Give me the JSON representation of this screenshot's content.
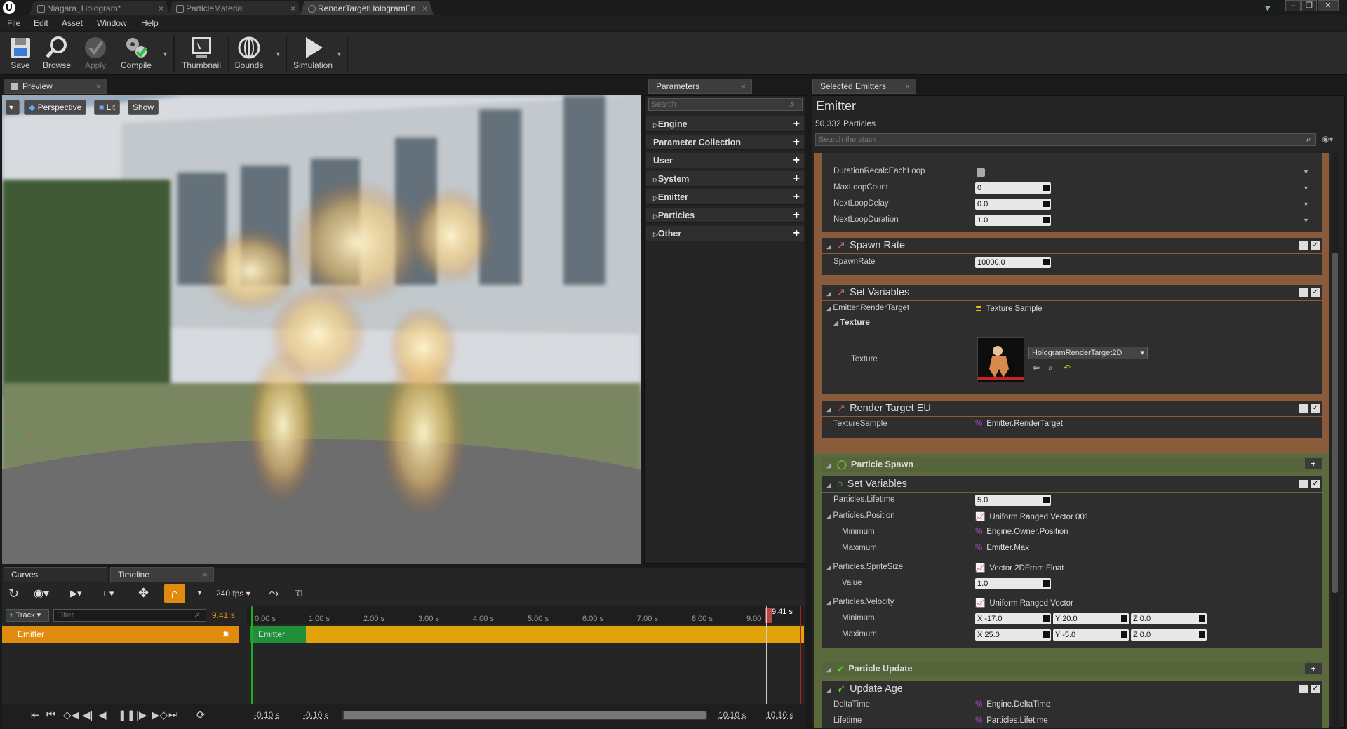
{
  "tabs": [
    {
      "label": "Niagara_Hologram*",
      "active": false
    },
    {
      "label": "ParticleMaterial",
      "active": false
    },
    {
      "label": "RenderTargetHologramEn",
      "active": true
    }
  ],
  "menu": [
    "File",
    "Edit",
    "Asset",
    "Window",
    "Help"
  ],
  "toolbar": {
    "save": "Save",
    "browse": "Browse",
    "apply": "Apply",
    "compile": "Compile",
    "thumbnail": "Thumbnail",
    "bounds": "Bounds",
    "simulation": "Simulation"
  },
  "preview": {
    "tab": "Preview",
    "perspective": "Perspective",
    "lit": "Lit",
    "show": "Show"
  },
  "parameters": {
    "tab": "Parameters",
    "search_placeholder": "Search",
    "rows": [
      "Engine",
      "Parameter Collection",
      "User",
      "System",
      "Emitter",
      "Particles",
      "Other"
    ]
  },
  "selected": {
    "tab": "Selected Emitters",
    "title": "Emitter",
    "particles": "50,332 Particles",
    "search_placeholder": "Search the stack"
  },
  "stack": {
    "top_rows": [
      {
        "label": "DurationRecalcEachLoop",
        "value": ""
      },
      {
        "label": "MaxLoopCount",
        "value": "0"
      },
      {
        "label": "NextLoopDelay",
        "value": "0.0"
      },
      {
        "label": "NextLoopDuration",
        "value": "1.0"
      }
    ],
    "spawn_rate": {
      "title": "Spawn Rate",
      "label": "SpawnRate",
      "value": "10000.0"
    },
    "set_vars1": {
      "title": "Set Variables",
      "row_label": "Emitter.RenderTarget",
      "row_value": "Texture Sample",
      "texture_group": "Texture",
      "texture_label": "Texture",
      "texture_asset": "HologramRenderTarget2D"
    },
    "render_target": {
      "title": "Render Target EU",
      "label": "TextureSample",
      "value": "Emitter.RenderTarget"
    },
    "particle_spawn": "Particle Spawn",
    "set_vars2": {
      "title": "Set Variables",
      "lifetime_label": "Particles.Lifetime",
      "lifetime": "5.0",
      "pos_label": "Particles.Position",
      "pos_value": "Uniform Ranged Vector 001",
      "min_label": "Minimum",
      "min_value": "Engine.Owner.Position",
      "max_label": "Maximum",
      "max_value": "Emitter.Max",
      "size_label": "Particles.SpriteSize",
      "size_value": "Vector 2DFrom Float",
      "value_label": "Value",
      "value": "1.0",
      "vel_label": "Particles.Velocity",
      "vel_value": "Uniform Ranged Vector",
      "vmin_label": "Minimum",
      "vmin": {
        "x": "X  -17.0",
        "y": "Y  20.0",
        "z": "Z  0.0"
      },
      "vmax_label": "Maximum",
      "vmax": {
        "x": "X  25.0",
        "y": "Y  -5.0",
        "z": "Z  0.0"
      }
    },
    "particle_update": "Particle Update",
    "update_age": {
      "title": "Update Age",
      "dt_label": "DeltaTime",
      "dt_value": "Engine.DeltaTime",
      "lt_label": "Lifetime",
      "lt_value": "Particles.Lifetime"
    }
  },
  "timeline": {
    "curves_tab": "Curves",
    "timeline_tab": "Timeline",
    "fps": "240 fps",
    "track_btn": "Track",
    "filter_placeholder": "Filter",
    "current_time": "9.41 s",
    "playhead_label": "9.41 s",
    "emitter": "Emitter",
    "ruler": [
      "0.00 s",
      "1.00 s",
      "2.00 s",
      "3.00 s",
      "4.00 s",
      "5.00 s",
      "6.00 s",
      "7.00 s",
      "8.00 s",
      "9.00"
    ],
    "range_start1": "-0.10 s",
    "range_start2": "-0.10 s",
    "range_end1": "10.10 s",
    "range_end2": "10.10 s"
  }
}
